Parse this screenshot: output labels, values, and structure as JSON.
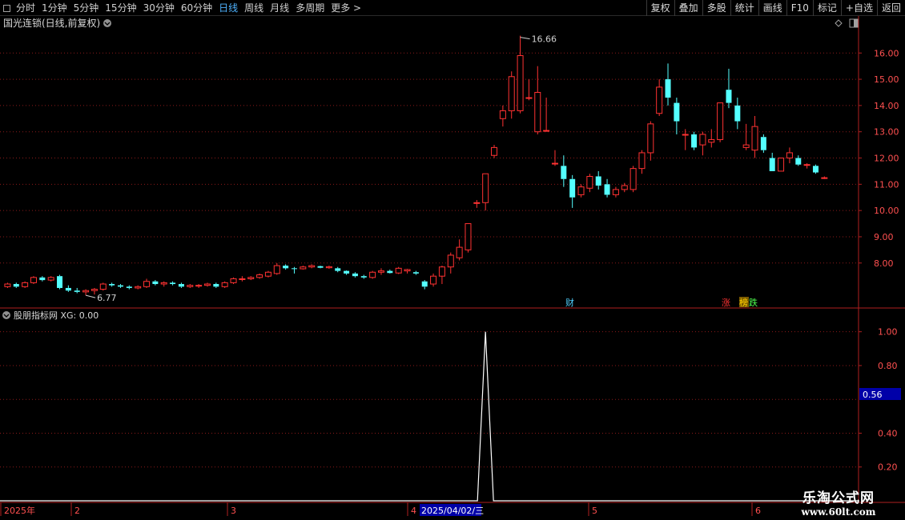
{
  "toolbar": {
    "periods": [
      {
        "label": "分时",
        "active": false
      },
      {
        "label": "1分钟",
        "active": false
      },
      {
        "label": "5分钟",
        "active": false
      },
      {
        "label": "15分钟",
        "active": false
      },
      {
        "label": "30分钟",
        "active": false
      },
      {
        "label": "60分钟",
        "active": false
      },
      {
        "label": "日线",
        "active": true
      },
      {
        "label": "周线",
        "active": false
      },
      {
        "label": "月线",
        "active": false
      },
      {
        "label": "多周期",
        "active": false
      },
      {
        "label": "更多 >",
        "active": false
      }
    ],
    "tools": [
      "复权",
      "叠加",
      "多股",
      "统计",
      "画线",
      "F10",
      "标记",
      "+自选",
      "返回"
    ]
  },
  "main_panel": {
    "title": "国光连锁(日线,前复权)",
    "high_marker": "16.66",
    "low_marker": "6.77",
    "event_labels": {
      "cai": "财",
      "zhang": "涨",
      "bang": "榜",
      "die": "跌"
    }
  },
  "indicator_panel": {
    "title": "股朋指标网 XG: 0.00",
    "current_value": "0.56"
  },
  "date_axis": {
    "labels": [
      "2025年",
      "2",
      "3",
      "4",
      "5",
      "6"
    ],
    "cursor_date": "2025/04/02/三"
  },
  "watermark": {
    "main": "乐淘公式网",
    "sub": "www.60lt.com"
  },
  "colors": {
    "up": "#ff3232",
    "down": "#54ffff",
    "grid": "#8b1a1a",
    "axis": "#b02020",
    "signal": "#ffffff",
    "highlight": "#0000a8"
  },
  "chart_data": [
    {
      "type": "candlestick",
      "ylim": [
        6.5,
        16.8
      ],
      "yticks": [
        "8.00",
        "9.00",
        "10.00",
        "11.00",
        "12.00",
        "13.00",
        "14.00",
        "15.00",
        "16.00"
      ],
      "ohlc": [
        [
          7.1,
          7.25,
          7.05,
          7.2
        ],
        [
          7.2,
          7.25,
          7.05,
          7.1
        ],
        [
          7.1,
          7.3,
          7.05,
          7.25
        ],
        [
          7.25,
          7.5,
          7.2,
          7.45
        ],
        [
          7.45,
          7.5,
          7.3,
          7.35
        ],
        [
          7.35,
          7.5,
          7.3,
          7.45
        ],
        [
          7.5,
          7.55,
          7.0,
          7.05
        ],
        [
          7.05,
          7.15,
          6.9,
          6.95
        ],
        [
          6.95,
          7.05,
          6.85,
          6.9
        ],
        [
          6.9,
          7.0,
          6.77,
          6.95
        ],
        [
          6.95,
          7.05,
          6.8,
          7.0
        ],
        [
          7.0,
          7.25,
          6.95,
          7.2
        ],
        [
          7.2,
          7.25,
          7.1,
          7.15
        ],
        [
          7.15,
          7.2,
          7.05,
          7.1
        ],
        [
          7.1,
          7.15,
          7.0,
          7.05
        ],
        [
          7.05,
          7.15,
          7.0,
          7.1
        ],
        [
          7.1,
          7.4,
          7.05,
          7.3
        ],
        [
          7.3,
          7.35,
          7.15,
          7.2
        ],
        [
          7.2,
          7.3,
          7.1,
          7.25
        ],
        [
          7.25,
          7.3,
          7.15,
          7.2
        ],
        [
          7.2,
          7.25,
          7.05,
          7.1
        ],
        [
          7.1,
          7.2,
          7.05,
          7.15
        ],
        [
          7.15,
          7.2,
          7.05,
          7.15
        ],
        [
          7.15,
          7.25,
          7.1,
          7.2
        ],
        [
          7.2,
          7.25,
          7.05,
          7.1
        ],
        [
          7.1,
          7.3,
          7.05,
          7.25
        ],
        [
          7.25,
          7.45,
          7.2,
          7.4
        ],
        [
          7.4,
          7.5,
          7.3,
          7.4
        ],
        [
          7.4,
          7.5,
          7.35,
          7.45
        ],
        [
          7.45,
          7.6,
          7.4,
          7.55
        ],
        [
          7.5,
          7.7,
          7.45,
          7.65
        ],
        [
          7.6,
          8.0,
          7.55,
          7.9
        ],
        [
          7.9,
          7.95,
          7.75,
          7.8
        ],
        [
          7.8,
          7.85,
          7.6,
          7.78
        ],
        [
          7.78,
          7.9,
          7.75,
          7.85
        ],
        [
          7.85,
          7.95,
          7.8,
          7.9
        ],
        [
          7.88,
          7.9,
          7.8,
          7.82
        ],
        [
          7.82,
          7.9,
          7.78,
          7.86
        ],
        [
          7.8,
          7.85,
          7.65,
          7.7
        ],
        [
          7.7,
          7.72,
          7.55,
          7.6
        ],
        [
          7.6,
          7.65,
          7.45,
          7.5
        ],
        [
          7.5,
          7.55,
          7.4,
          7.45
        ],
        [
          7.45,
          7.7,
          7.4,
          7.65
        ],
        [
          7.65,
          7.8,
          7.55,
          7.7
        ],
        [
          7.7,
          7.75,
          7.6,
          7.62
        ],
        [
          7.62,
          7.85,
          7.58,
          7.8
        ],
        [
          7.7,
          7.78,
          7.6,
          7.75
        ],
        [
          7.65,
          7.7,
          7.55,
          7.6
        ],
        [
          7.3,
          7.35,
          7.0,
          7.1
        ],
        [
          7.2,
          7.6,
          7.1,
          7.5
        ],
        [
          7.5,
          7.9,
          7.2,
          7.85
        ],
        [
          7.85,
          8.4,
          7.6,
          8.3
        ],
        [
          8.2,
          8.9,
          8.1,
          8.6
        ],
        [
          8.5,
          9.5,
          8.4,
          9.5
        ],
        [
          10.3,
          10.4,
          10.1,
          10.3
        ],
        [
          10.3,
          11.4,
          10.0,
          11.4
        ],
        [
          12.1,
          12.5,
          12.0,
          12.4
        ],
        [
          13.5,
          14.0,
          13.2,
          13.8
        ],
        [
          13.8,
          15.3,
          13.5,
          15.1
        ],
        [
          13.8,
          16.66,
          13.7,
          15.9
        ],
        [
          14.3,
          15.0,
          14.2,
          14.3
        ],
        [
          13.0,
          15.5,
          12.9,
          14.5
        ],
        [
          13.05,
          14.3,
          13.0,
          13.05
        ],
        [
          11.8,
          12.3,
          11.7,
          11.8
        ],
        [
          11.7,
          12.1,
          10.9,
          11.2
        ],
        [
          11.2,
          11.35,
          10.1,
          10.5
        ],
        [
          10.6,
          11.0,
          10.5,
          10.9
        ],
        [
          10.85,
          11.4,
          10.7,
          11.3
        ],
        [
          11.3,
          11.5,
          10.8,
          10.95
        ],
        [
          11.0,
          11.2,
          10.5,
          10.6
        ],
        [
          10.6,
          10.9,
          10.5,
          10.8
        ],
        [
          10.8,
          11.05,
          10.7,
          10.95
        ],
        [
          10.8,
          11.7,
          10.7,
          11.6
        ],
        [
          11.6,
          12.3,
          11.4,
          12.2
        ],
        [
          12.2,
          13.4,
          11.9,
          13.3
        ],
        [
          13.7,
          15.0,
          13.6,
          14.7
        ],
        [
          15.0,
          15.6,
          14.0,
          14.3
        ],
        [
          14.1,
          14.3,
          12.9,
          13.4
        ],
        [
          12.9,
          13.1,
          12.3,
          12.9
        ],
        [
          12.9,
          13.0,
          12.3,
          12.4
        ],
        [
          12.5,
          13.0,
          12.1,
          12.9
        ],
        [
          12.6,
          13.1,
          12.4,
          12.7
        ],
        [
          12.7,
          14.1,
          12.6,
          14.1
        ],
        [
          14.6,
          15.4,
          13.9,
          14.1
        ],
        [
          14.0,
          14.3,
          13.1,
          13.4
        ],
        [
          12.4,
          13.3,
          12.3,
          12.5
        ],
        [
          12.3,
          13.6,
          12.0,
          13.2
        ],
        [
          12.8,
          12.9,
          12.2,
          12.3
        ],
        [
          12.0,
          12.2,
          11.5,
          11.5
        ],
        [
          11.5,
          12.0,
          11.5,
          12.0
        ],
        [
          12.0,
          12.4,
          11.8,
          12.2
        ],
        [
          12.0,
          12.1,
          11.7,
          11.75
        ],
        [
          11.72,
          11.8,
          11.6,
          11.75
        ],
        [
          11.7,
          11.75,
          11.4,
          11.45
        ],
        [
          11.25,
          11.3,
          11.2,
          11.25
        ]
      ]
    },
    {
      "type": "line",
      "name": "XG",
      "ylim": [
        0,
        1.06
      ],
      "yticks": [
        "0.20",
        "0.40",
        "0.80",
        "1.00"
      ],
      "signal_index": 55,
      "signal_value": 1.0
    }
  ]
}
